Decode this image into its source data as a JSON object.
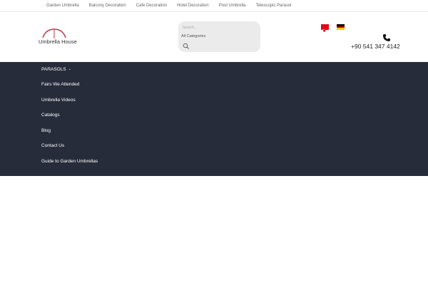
{
  "topbar": {
    "links": [
      "Garden Umbrella",
      "Balcony Decoration",
      "Cafe Decoration",
      "Hotel Decoration",
      "Pool Umbrella",
      "Telescopic Parasol"
    ]
  },
  "header": {
    "logo_text": "Umbrella House",
    "search": {
      "placeholder": "Search...",
      "category": "All Categories"
    },
    "phone": "+90 541 347 4142"
  },
  "nav": {
    "items": [
      "PARASOLS",
      "Fairs We Attended",
      "Umbrella Videos",
      "Catalogs",
      "Blog",
      "Contact Us",
      "Guide to Garden Umbrellas"
    ]
  },
  "colors": {
    "nav_bg": "#272c3b",
    "logo_accent": "#b03a48"
  }
}
